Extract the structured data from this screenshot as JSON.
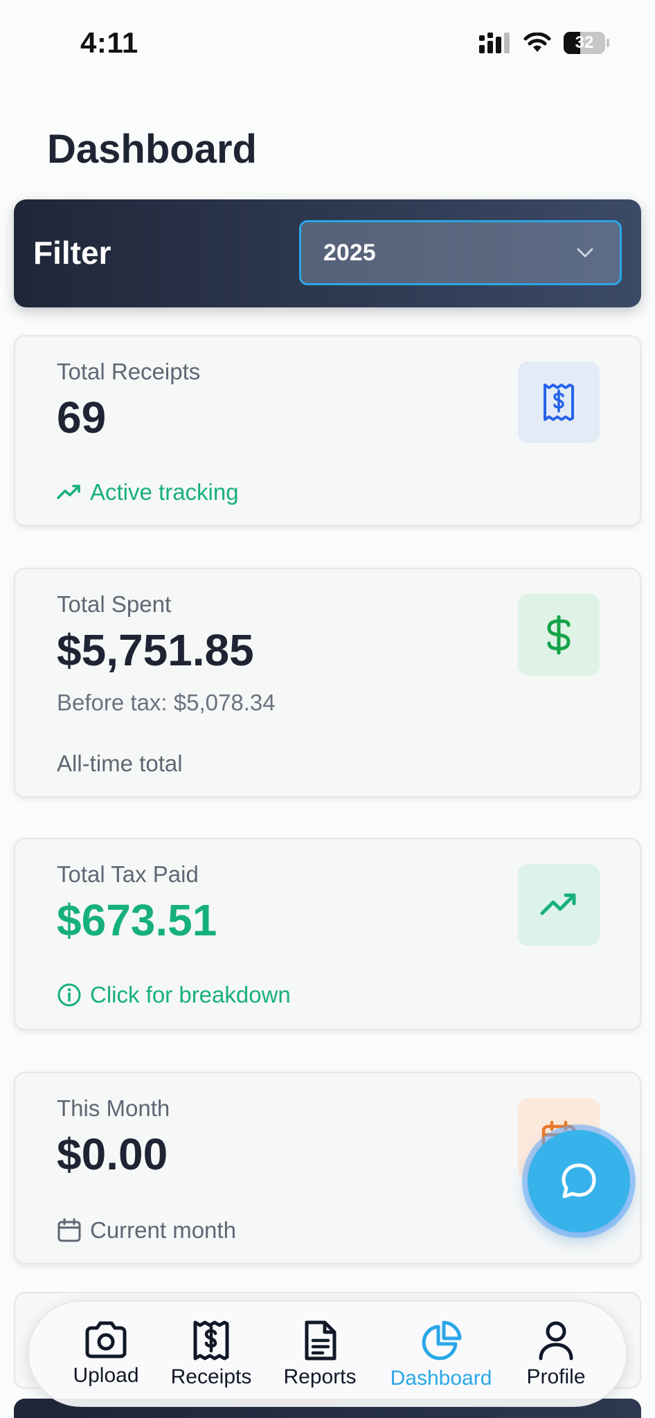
{
  "status_bar": {
    "time": "4:11",
    "battery": "32"
  },
  "page": {
    "title": "Dashboard"
  },
  "filter": {
    "label": "Filter",
    "selected": "2025"
  },
  "cards": [
    {
      "label": "Total Receipts",
      "value": "69",
      "footer": "Active tracking",
      "icon": "receipt-dollar-icon",
      "accent": "#2563eb"
    },
    {
      "label": "Total Spent",
      "value": "$5,751.85",
      "subtext": "Before tax: $5,078.34",
      "footer": "All-time total",
      "icon": "dollar-icon",
      "accent": "#16a34a"
    },
    {
      "label": "Total Tax Paid",
      "value": "$673.51",
      "footer": "Click for breakdown",
      "icon": "trending-up-icon",
      "accent": "#16b07c"
    },
    {
      "label": "This Month",
      "value": "$0.00",
      "footer": "Current month",
      "icon": "calendar-icon",
      "accent": "#ea7a2a"
    }
  ],
  "nav": {
    "items": [
      {
        "label": "Upload",
        "icon": "camera-icon"
      },
      {
        "label": "Receipts",
        "icon": "receipt-icon"
      },
      {
        "label": "Reports",
        "icon": "document-icon"
      },
      {
        "label": "Dashboard",
        "icon": "pie-chart-icon",
        "active": true
      },
      {
        "label": "Profile",
        "icon": "user-icon"
      }
    ]
  },
  "colors": {
    "accent_blue": "#2aa7e6",
    "green": "#16b07c",
    "dark": "#1e2433"
  }
}
